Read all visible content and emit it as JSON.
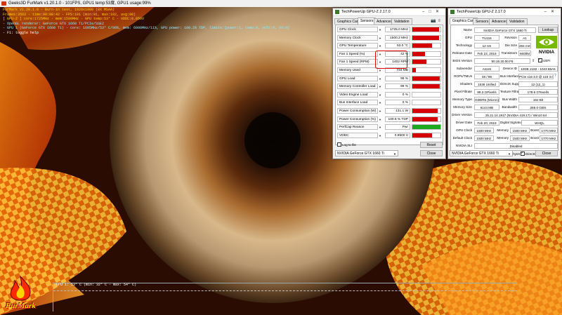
{
  "furmark": {
    "window_title": "Geeks3D FurMark v1.20.1.0 - 101FPS, GPU1 temp:53度, GPU1 usage:99%",
    "osd": [
      {
        "text": "FurMark v1.20.1.0 - Burn-in test, 1920x1080 (8X MSAA)",
        "color": "yellow"
      },
      {
        "text": "Frames:3563 - time:00:00:42 - FPS:101 (min:91, max:102, avg:98)",
        "color": "yellow"
      },
      {
        "text": "[ GPU-Z ] core:1725MHz - mem:1500MHz - GPU temp:53° C - VDDC:0.850V",
        "color": "yellow"
      },
      {
        "text": "- OpenGL renderer: GeForce GTX 1660 Ti/PCIe/SSE2",
        "color": "cyan"
      },
      {
        "text": "- GPU 1 (GeForce GTX 1660 Ti) - core: 1695MHz/53° C/99%, mem: 6000MHz/11%, GPU power: 100.2% TDP, limits:[power:1, temp:0, volt:0, OV:0]",
        "color": "cyan"
      },
      {
        "text": "- F1: toggle help",
        "color": "white"
      }
    ],
    "graph_label": "GPU 1: 53° C (min: 32° C - max: 54° C)",
    "logo_text": "FurMark"
  },
  "gpuz_sensors": {
    "title": "TechPowerUp GPU-Z 2.17.0",
    "tabs": [
      "Graphics Card",
      "Sensors",
      "Advanced",
      "Validation"
    ],
    "active_tab": "Sensors",
    "rows": [
      {
        "name": "GPU Clock",
        "value": "1725.0 MHz",
        "fill": 0.95
      },
      {
        "name": "Memory Clock",
        "value": "1500.2 MHz",
        "fill": 0.95
      },
      {
        "name": "GPU Temperature",
        "value": "53.0 °C",
        "fill": 0.7
      },
      {
        "name": "Fan 1 Speed (%)",
        "value": "42 %",
        "fill": 0.45
      },
      {
        "name": "Fan 1 Speed (RPM)",
        "value": "1402 RPM",
        "fill": 0.5
      },
      {
        "name": "Memory Used",
        "value": "734 MB",
        "fill": 0.12
      },
      {
        "name": "GPU Load",
        "value": "99 %",
        "fill": 0.97
      },
      {
        "name": "Memory Controller Load",
        "value": "99 %",
        "fill": 0.97
      },
      {
        "name": "Video Engine Load",
        "value": "0 %",
        "fill": 0
      },
      {
        "name": "Bus Interface Load",
        "value": "0 %",
        "fill": 0
      },
      {
        "name": "Power Consumption (W)",
        "value": "131.1 W",
        "fill": 0.9
      },
      {
        "name": "Power Consumption (%)",
        "value": "100.8 % TDP",
        "fill": 0.9
      },
      {
        "name": "PerfCap Reason",
        "value": "Pwr",
        "fill": 1,
        "color": "#1ea81e"
      },
      {
        "name": "VDDC",
        "value": "0.8500 V",
        "fill": 0.7
      }
    ],
    "log_to_file": "Log to file",
    "reset_button": "Reset",
    "device_select": "NVIDIA GeForce GTX 1660 Ti",
    "close_button": "Close",
    "bar_color": "#d60000"
  },
  "gpuz_card": {
    "title": "TechPowerUp GPU-Z 2.17.0",
    "tabs": [
      "Graphics Card",
      "Sensors",
      "Advanced",
      "Validation"
    ],
    "active_tab": "Graphics Card",
    "name_label": "Name",
    "name_value": "NVIDIA GeForce GTX 1660 Ti",
    "lookup_button": "Lookup",
    "gpu_label": "GPU",
    "gpu_value": "TU116",
    "revision_label": "Revision",
    "revision_value": "A1",
    "technology_label": "Technology",
    "technology_value": "12 nm",
    "diesize_label": "Die Size",
    "diesize_value": "284 mm²",
    "release_label": "Release Date",
    "release_value": "Feb 22, 2019",
    "transistors_label": "Transistors",
    "transistors_value": "6600M",
    "bios_label": "BIOS Version",
    "bios_value": "90.16.20.00.F6",
    "uefi_label": "UEFI",
    "subvendor_label": "Subvendor",
    "subvendor_value": "ASUS",
    "deviceid_label": "Device ID",
    "deviceid_value": "10DE 2182 - 1043 86A5",
    "rops_label": "ROPs/TMUs",
    "rops_value": "48 / 96",
    "bus_label": "Bus Interface",
    "bus_value": "PCIe x16 3.0 @ x16 3.0",
    "shaders_label": "Shaders",
    "shaders_value": "1536 Unified",
    "dx_label": "DirectX Support",
    "dx_value": "12 (12_1)",
    "pixel_label": "Pixel Fillrate",
    "pixel_value": "89.3 GPixel/s",
    "texture_label": "Texture Fillrate",
    "texture_value": "178.6 GTexel/s",
    "memtype_label": "Memory Type",
    "memtype_value": "GDDR6 (Micron)",
    "buswidth_label": "Bus Width",
    "buswidth_value": "192 Bit",
    "memsize_label": "Memory Size",
    "memsize_value": "6144 MB",
    "bandwidth_label": "Bandwidth",
    "bandwidth_value": "288.0 GB/s",
    "driver_label": "Driver Version",
    "driver_value": "25.21.14.1917 (NVIDIA 419.17) / Win10 64",
    "driverdate_label": "Driver Date",
    "driverdate_value": "Feb 20, 2019",
    "digsig_label": "Digital Signature",
    "digsig_value": "WHQL",
    "gpuclock_label": "GPU Clock",
    "gpuclock_value": "1500 MHz",
    "mem_label": "Memory",
    "gpuclock_mem": "1500 MHz",
    "boost_label": "Boost",
    "gpuclock_boost": "1770 MHz",
    "defclock_label": "Default Clock",
    "defclock_value": "1500 MHz",
    "defclock_mem": "1500 MHz",
    "defclock_boost": "1770 MHz",
    "sli_label": "NVIDIA SLI",
    "sli_value": "Disabled",
    "computing_label": "Computing",
    "opencl": "OpenCL",
    "cuda": "CUDA",
    "physx": "PhysX",
    "directcompute": "DirectCompute 5.0",
    "device_select": "NVIDIA GeForce GTX 1660 Ti",
    "close_button": "Close",
    "logo_brand": "nvidia"
  }
}
